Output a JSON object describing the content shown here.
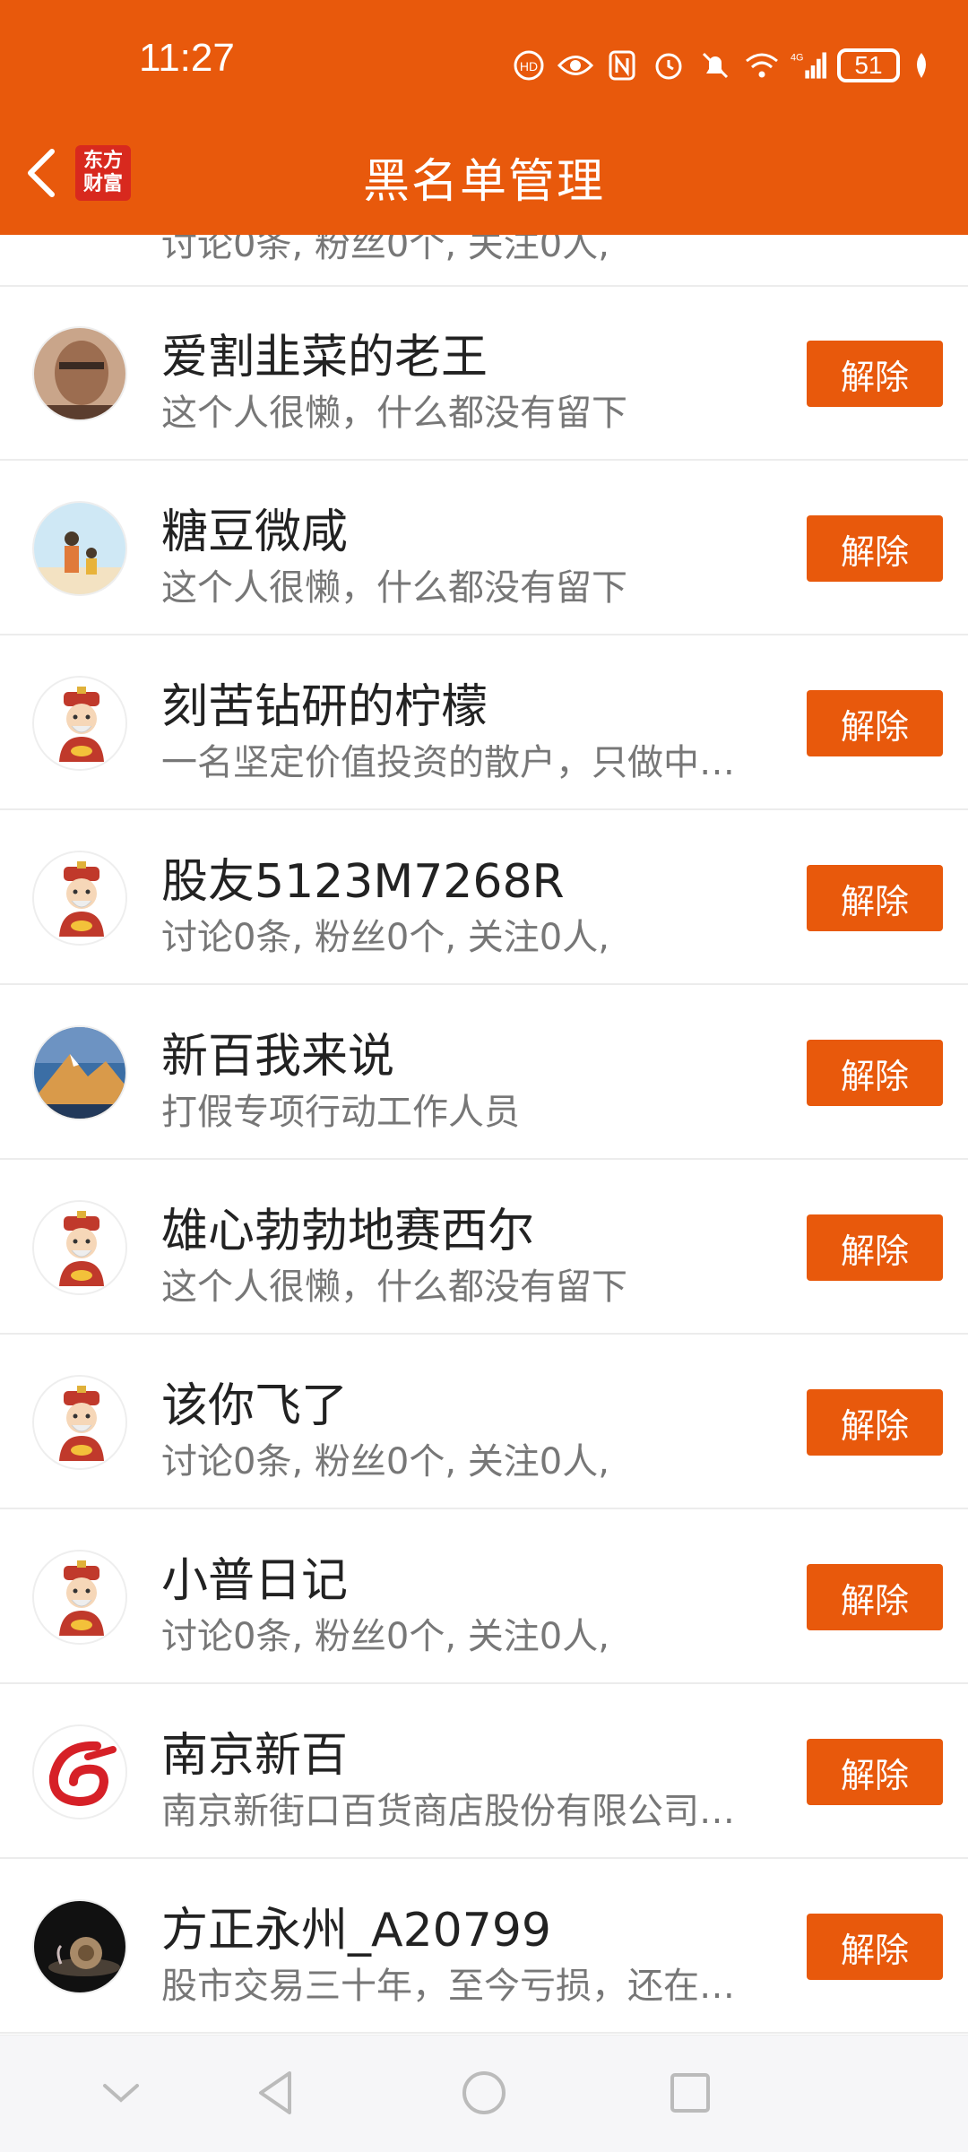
{
  "status_bar": {
    "time": "11:27",
    "battery": "51"
  },
  "header": {
    "title": "黑名单管理",
    "logo_line1": "东方",
    "logo_line2": "财富"
  },
  "partial_row": {
    "desc": "讨论0条, 粉丝0个, 关注0人,"
  },
  "unblock_label": "解除",
  "rows": [
    {
      "name": "爱割韭菜的老王",
      "desc": "这个人很懒，什么都没有留下",
      "avatar": "portrait"
    },
    {
      "name": "糖豆微咸",
      "desc": "这个人很懒，什么都没有留下",
      "avatar": "illustration"
    },
    {
      "name": "刻苦钻研的柠檬",
      "desc": "一名坚定价值投资的散户，只做中…",
      "avatar": "default"
    },
    {
      "name": "股友5123M7268R",
      "desc": "讨论0条, 粉丝0个, 关注0人,",
      "avatar": "default"
    },
    {
      "name": "新百我来说",
      "desc": "打假专项行动工作人员",
      "avatar": "mountain"
    },
    {
      "name": "雄心勃勃地赛西尔",
      "desc": "这个人很懒，什么都没有留下",
      "avatar": "default"
    },
    {
      "name": "该你飞了",
      "desc": "讨论0条, 粉丝0个, 关注0人,",
      "avatar": "default"
    },
    {
      "name": "小普日记",
      "desc": "讨论0条, 粉丝0个, 关注0人,",
      "avatar": "default"
    },
    {
      "name": "南京新百",
      "desc": "南京新街口百货商店股份有限公司…",
      "avatar": "logo"
    },
    {
      "name": "方正永州_A20799",
      "desc": "股市交易三十年，至今亏损，还在…",
      "avatar": "snail"
    }
  ]
}
